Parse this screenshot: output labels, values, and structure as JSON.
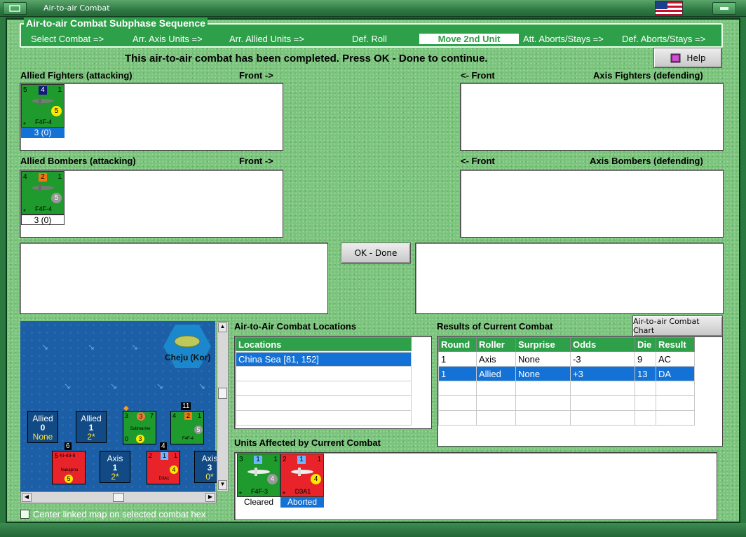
{
  "window": {
    "title": "Air-to-air Combat"
  },
  "sequence": {
    "legend": "Air-to-air Combat Subphase Sequence",
    "items": [
      {
        "label": "Select Combat =>"
      },
      {
        "label": "Arr. Axis Units =>"
      },
      {
        "label": "Arr. Allied Units =>"
      },
      {
        "label": "Def. Roll"
      },
      {
        "label": "Move 2nd Unit"
      },
      {
        "label": "Att. Aborts/Stays =>"
      },
      {
        "label": "Def. Aborts/Stays =>"
      }
    ],
    "active_index": 4
  },
  "message": "This air-to-air combat has been completed.  Press OK - Done to continue.",
  "help_button": "Help",
  "sections": {
    "allied_fighters": {
      "title": "Allied Fighters (attacking)",
      "front": "Front ->"
    },
    "axis_fighters": {
      "title": "Axis Fighters (defending)",
      "front": "<- Front"
    },
    "allied_bombers": {
      "title": "Allied Bombers (attacking)",
      "front": "Front ->"
    },
    "axis_bombers": {
      "title": "Axis Bombers (defending)",
      "front": "<- Front"
    }
  },
  "allied_fighter_unit": {
    "name": "F4F-4",
    "tl": "5",
    "badge": "4",
    "tr": "1",
    "value": "5",
    "tag": "3 (0)",
    "star": "*"
  },
  "allied_bomber_unit": {
    "name": "F4F-4",
    "tl": "4",
    "badge": "2",
    "tr": "1",
    "value": "5",
    "tag": "3 (0)",
    "star": "*"
  },
  "ok_button": "OK - Done",
  "map": {
    "hex_label": "Cheju (Kor)",
    "stacks": [
      {
        "top": "Allied",
        "mid": "0",
        "bot": "None"
      },
      {
        "top": "Allied",
        "mid": "1",
        "bot": "2*"
      },
      {
        "top": "Axis",
        "mid": "1",
        "bot": "2*"
      },
      {
        "top": "Axis",
        "mid": "3",
        "bot": "0*"
      }
    ],
    "counters": {
      "submarine": {
        "name": "Submarine",
        "tl": "3",
        "badge": "3",
        "tr": "7",
        "bl": "0",
        "value": "3"
      },
      "f4f": {
        "name": "F4F-4",
        "tl": "4",
        "badge": "2",
        "tr": "1",
        "value": "5",
        "stack": "11"
      },
      "ki43": {
        "name": "Ki-43-II",
        "tl": "5",
        "value": "5",
        "stack": "6",
        "sub": "Nakajima"
      },
      "d3a1": {
        "name": "D3A1",
        "tl": "2",
        "badge": "1",
        "tr": "1",
        "value": "4",
        "stack": "4"
      }
    }
  },
  "center_checkbox": {
    "label": "Center linked map on selected combat hex",
    "checked": false
  },
  "locations": {
    "title": "Air-to-Air Combat Locations",
    "header": "Locations",
    "rows": [
      "China Sea [81, 152]",
      "",
      "",
      "",
      ""
    ],
    "selected": 0
  },
  "results": {
    "title": "Results of Current Combat",
    "chart_button": "Air-to-air Combat Chart",
    "columns": [
      "Round",
      "Roller",
      "Surprise",
      "Odds",
      "Die",
      "Result"
    ],
    "rows": [
      [
        "1",
        "Axis",
        "None",
        "-3",
        "9",
        "AC"
      ],
      [
        "1",
        "Allied",
        "None",
        "+3",
        "13",
        "DA"
      ],
      [
        "",
        "",
        "",
        "",
        "",
        ""
      ],
      [
        "",
        "",
        "",
        "",
        "",
        ""
      ],
      [
        "",
        "",
        "",
        "",
        "",
        ""
      ]
    ],
    "selected": 1
  },
  "affected": {
    "title": "Units Affected by Current Combat",
    "units": [
      {
        "name": "F4F-3",
        "tl": "3",
        "badge": "1",
        "tr": "1",
        "value": "4",
        "status": "Cleared",
        "star": "*"
      },
      {
        "name": "D3A1",
        "tl": "2",
        "badge": "1",
        "tr": "1",
        "value": "4",
        "status": "Aborted",
        "star": "*"
      }
    ]
  },
  "colors": {
    "allied": "#1e9b2c",
    "axis": "#e8242a",
    "selection": "#1472d6",
    "header_green": "#2fa04a"
  }
}
